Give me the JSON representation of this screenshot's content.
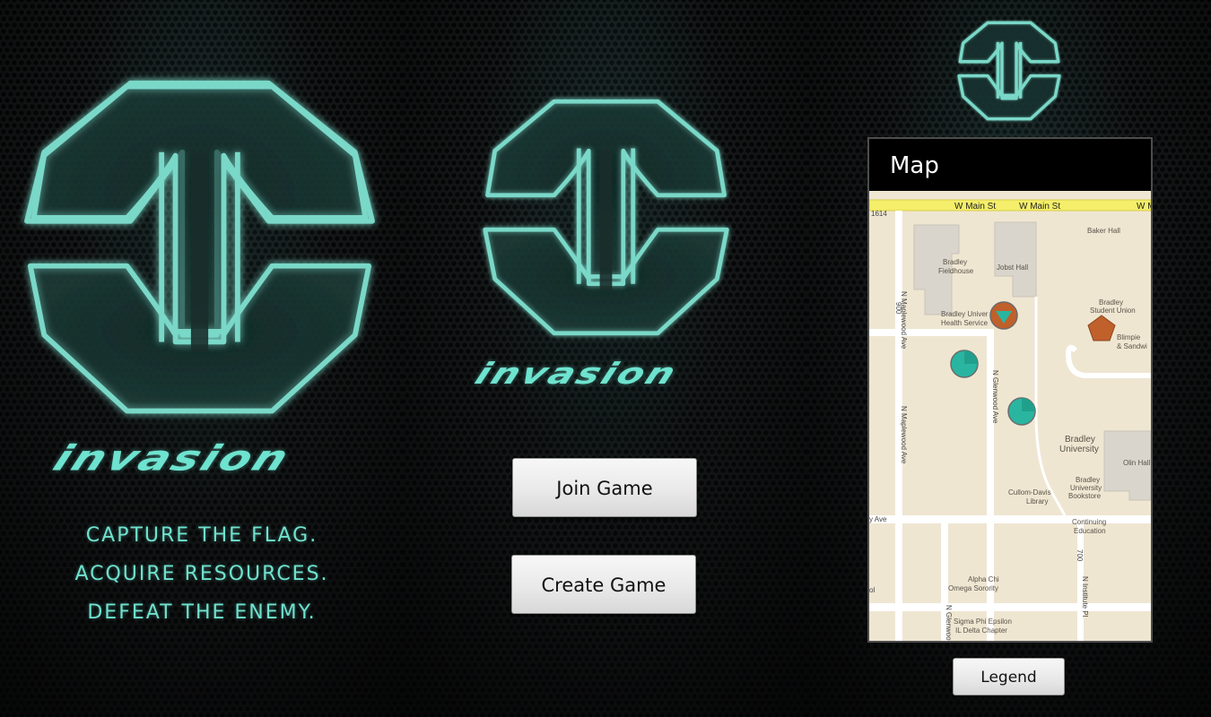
{
  "screens": {
    "splash": {
      "logo_icon": "invasion-emblem-icon",
      "wordmark": "invasion",
      "taglines": [
        "CAPTURE THE FLAG.",
        "ACQUIRE RESOURCES.",
        "DEFEAT THE ENEMY."
      ]
    },
    "menu": {
      "logo_icon": "invasion-emblem-icon",
      "wordmark": "invasion",
      "join_label": "Join Game",
      "create_label": "Create Game"
    },
    "map": {
      "logo_icon": "invasion-emblem-icon",
      "title": "Map",
      "legend_label": "Legend",
      "streets": {
        "main_left": "W Main St",
        "main_right": "W Main St",
        "main_edge": "W M",
        "maplewood_top": "N Maplewood Ave",
        "maplewood_bottom": "N Maplewood Ave",
        "glenwood_mid": "N Glenwood Ave",
        "glenwood_bottom": "N Glenwood",
        "institute": "N Institute Pl",
        "bradley_ave": "y Ave",
        "num_1614": "1614",
        "num_900": "900",
        "num_700": "700",
        "edge_ol": "ol"
      },
      "places": {
        "baker_hall": "Baker Hall",
        "fieldhouse_1": "Bradley",
        "fieldhouse_2": "Fieldhouse",
        "jobst_hall": "Jobst Hall",
        "health_1": "Bradley Univer",
        "health_2": "Health Service",
        "union_1": "Bradley",
        "union_2": "Student Union",
        "blimpie_1": "Blimpie",
        "blimpie_2": "& Sandwi",
        "university_1": "Bradley",
        "university_2": "University",
        "olin_hall": "Olin Hall",
        "library_1": "Cullom-Davis",
        "library_2": "Library",
        "bookstore_1": "Bradley",
        "bookstore_2": "University",
        "bookstore_3": "Bookstore",
        "cont_ed_1": "Continuing",
        "cont_ed_2": "Education",
        "alpha_1": "Alpha Chi",
        "alpha_2": "Omega Sorority",
        "sigma_1": "Sigma Phi Epsilon",
        "sigma_2": "IL Delta Chapter"
      },
      "markers": [
        {
          "name": "player-marker-1",
          "kind": "teal-circle"
        },
        {
          "name": "player-marker-2",
          "kind": "teal-circle"
        },
        {
          "name": "enemy-flag-marker",
          "kind": "orange-circle-teal-triangle"
        },
        {
          "name": "resource-marker",
          "kind": "orange-pentagon"
        }
      ],
      "colors": {
        "teal": "#2ab5a0",
        "orange": "#c0602a",
        "road": "#ffffff",
        "main_road": "#f4ee6a",
        "land": "#efe6d2",
        "building": "#dcd7cd"
      }
    }
  },
  "colors": {
    "neon_teal": "#6ee3cf",
    "button_text": "#111111"
  }
}
